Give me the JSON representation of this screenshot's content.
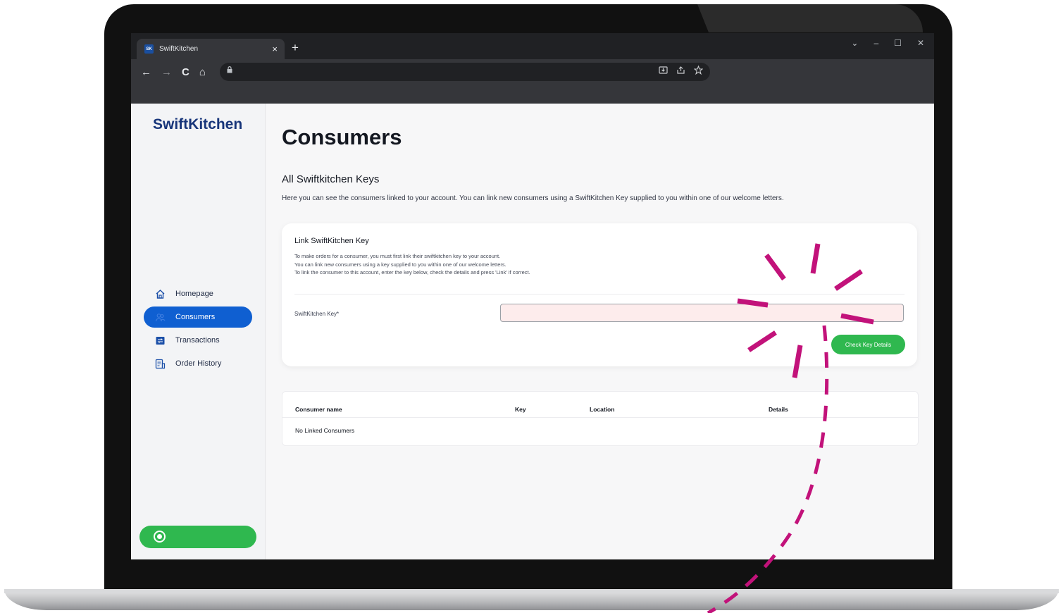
{
  "browser": {
    "tab_title": "SwiftKitchen",
    "tab_favicon": "SK",
    "tab_close": "×",
    "new_tab": "+",
    "window_controls": [
      "⌄",
      "–",
      "☐",
      "✕"
    ],
    "nav": {
      "back": "←",
      "forward": "→",
      "reload": "C",
      "home": "⌂"
    },
    "lock": "🔒",
    "omnibox_icons": [
      "download-icon",
      "share-icon",
      "star-icon"
    ]
  },
  "app": {
    "logo": "SwiftKitchen",
    "nav": [
      {
        "label": "Homepage",
        "icon": "home-icon",
        "active": false
      },
      {
        "label": "Consumers",
        "icon": "consumers-icon",
        "active": true
      },
      {
        "label": "Transactions",
        "icon": "transactions-icon",
        "active": false
      },
      {
        "label": "Order History",
        "icon": "order-history-icon",
        "active": false
      }
    ],
    "account_button_icon": "user-circle-icon"
  },
  "page": {
    "title": "Consumers",
    "section_title": "All Swiftkitchen Keys",
    "section_desc": "Here you can see the consumers linked to your account. You can link new consumers using a SwiftKitchen Key supplied to you within one of our welcome letters."
  },
  "link_card": {
    "title": "Link SwiftKitchen Key",
    "desc_lines": [
      "To make orders for a consumer, you must first link their swiftkitchen key to your account.",
      "You can link new consumers using a key supplied to you within one of our welcome letters.",
      "To link the consumer to this account, enter the key below, check the details and press 'Link' if correct."
    ],
    "key_label": "SwiftKitchen Key*",
    "key_value": "",
    "check_button": "Check Key Details"
  },
  "table": {
    "headers": [
      "Consumer name",
      "Key",
      "Location",
      "Details"
    ],
    "empty_text": "No Linked Consumers"
  },
  "colors": {
    "brand_blue": "#17357a",
    "active_nav": "#0f5fd1",
    "green": "#2fb84f",
    "highlight": "#c2127a"
  }
}
